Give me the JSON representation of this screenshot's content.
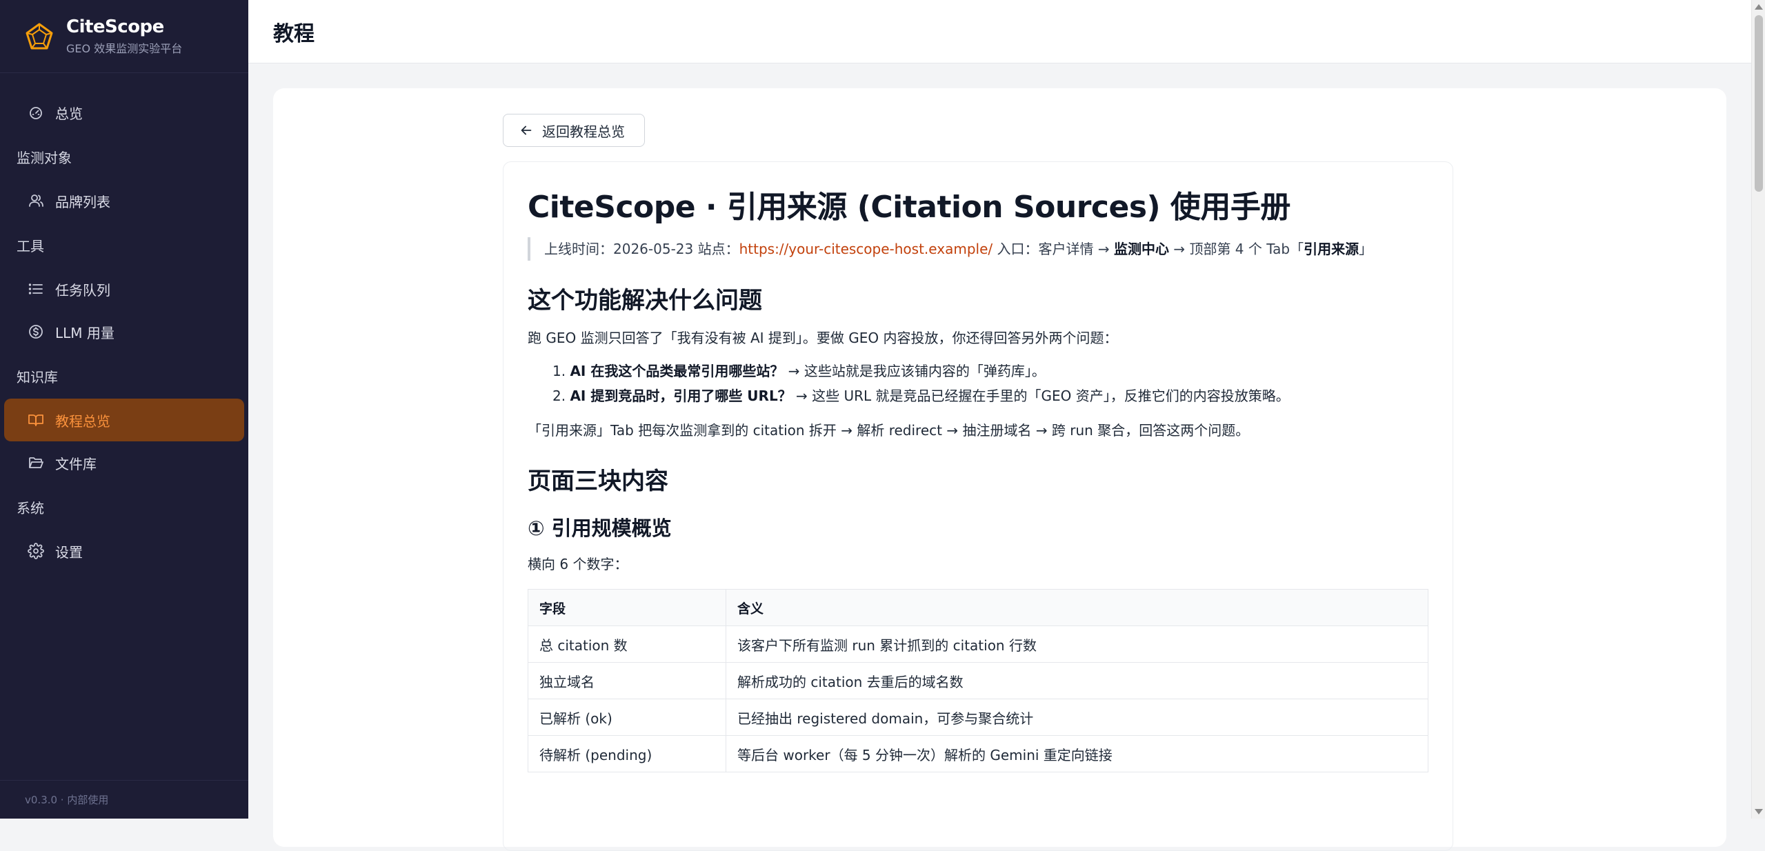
{
  "brand": {
    "name": "CiteScope",
    "subtitle": "GEO 效果监测实验平台"
  },
  "sidebar": {
    "items": [
      {
        "type": "item",
        "label": "总览",
        "icon": "dashboard-icon"
      },
      {
        "type": "group",
        "label": "监测对象"
      },
      {
        "type": "item",
        "label": "品牌列表",
        "icon": "users-icon"
      },
      {
        "type": "group",
        "label": "工具"
      },
      {
        "type": "item",
        "label": "任务队列",
        "icon": "list-icon"
      },
      {
        "type": "item",
        "label": "LLM 用量",
        "icon": "dollar-circle-icon"
      },
      {
        "type": "group",
        "label": "知识库"
      },
      {
        "type": "item",
        "label": "教程总览",
        "icon": "book-open-icon",
        "active": true
      },
      {
        "type": "item",
        "label": "文件库",
        "icon": "folder-open-icon"
      },
      {
        "type": "group",
        "label": "系统"
      },
      {
        "type": "item",
        "label": "设置",
        "icon": "gear-icon"
      }
    ],
    "footer": "v0.3.0 · 内部使用"
  },
  "header": {
    "title": "教程"
  },
  "back_button": {
    "label": "返回教程总览",
    "icon": "arrow-left-icon"
  },
  "doc": {
    "title": "CiteScope · 引用来源 (Citation Sources) 使用手册",
    "meta": {
      "launch_prefix": "上线时间：2026-05-23 站点：",
      "site_url": "https://your-citescope-host.example/",
      "entry_prefix": " 入口：客户详情 → ",
      "entry_bold_1": "监测中心",
      "entry_middle": " → 顶部第 4 个 Tab「",
      "entry_bold_2": "引用来源",
      "entry_suffix": "」"
    },
    "section1_title": "这个功能解决什么问题",
    "section1_intro": "跑 GEO 监测只回答了「我有没有被 AI 提到」。要做 GEO 内容投放，你还得回答另外两个问题：",
    "questions": [
      {
        "num": "1.",
        "bold": "AI 在我这个品类最常引用哪些站？",
        "rest": " → 这些站就是我应该铺内容的「弹药库」。"
      },
      {
        "num": "2.",
        "bold": "AI 提到竞品时，引用了哪些 URL？",
        "rest": " → 这些 URL 就是竞品已经握在手里的「GEO 资产」，反推它们的内容投放策略。"
      }
    ],
    "section1_outro": "「引用来源」Tab 把每次监测拿到的 citation 拆开 → 解析 redirect → 抽注册域名 → 跨 run 聚合，回答这两个问题。",
    "section2_title": "页面三块内容",
    "sub1_title": "① 引用规模概览",
    "sub1_intro": "横向 6 个数字：",
    "table": {
      "headers": [
        "字段",
        "含义"
      ],
      "rows": [
        [
          "总 citation 数",
          "该客户下所有监测 run 累计抓到的 citation 行数"
        ],
        [
          "独立域名",
          "解析成功的 citation 去重后的域名数"
        ],
        [
          "已解析 (ok)",
          "已经抽出 registered domain，可参与聚合统计"
        ],
        [
          "待解析 (pending)",
          "等后台 worker（每 5 分钟一次）解析的 Gemini 重定向链接"
        ]
      ]
    }
  }
}
